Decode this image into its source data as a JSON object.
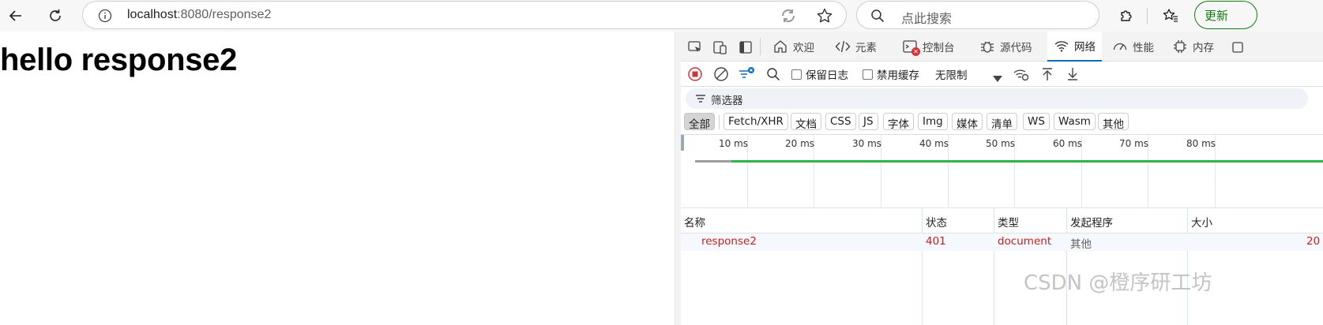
{
  "browser": {
    "address": {
      "host": "localhost",
      "rest": ":8080/response2"
    },
    "search_placeholder": "点此搜索",
    "update_label": "更新"
  },
  "page": {
    "heading": "hello response2"
  },
  "devtools": {
    "tabs": [
      {
        "label": "欢迎",
        "icon": "home-icon"
      },
      {
        "label": "元素",
        "icon": "code-icon"
      },
      {
        "label": "控制台",
        "icon": "console-icon"
      },
      {
        "label": "源代码",
        "icon": "bug-icon"
      },
      {
        "label": "网络",
        "icon": "wifi-icon",
        "active": true
      },
      {
        "label": "性能",
        "icon": "gauge-icon"
      },
      {
        "label": "内存",
        "icon": "chip-icon"
      }
    ],
    "network_toolbar": {
      "preserve_log": "保留日志",
      "disable_cache": "禁用缓存",
      "throttle": "无限制"
    },
    "filter_placeholder": "筛选器",
    "type_filters": [
      "全部",
      "Fetch/XHR",
      "文档",
      "CSS",
      "JS",
      "字体",
      "Img",
      "媒体",
      "清单",
      "WS",
      "Wasm",
      "其他"
    ],
    "timeline_ticks": [
      "10 ms",
      "20 ms",
      "30 ms",
      "40 ms",
      "50 ms",
      "60 ms",
      "70 ms",
      "80 ms"
    ],
    "columns": [
      "名称",
      "状态",
      "类型",
      "发起程序",
      "大小"
    ],
    "requests": [
      {
        "name": "response2",
        "status": "401",
        "type": "document",
        "initiator": "其他",
        "size": "20"
      }
    ],
    "colors": {
      "error_text": "#c5221f",
      "active_tab": "#0f6cbd",
      "download_bar": "#32b34a"
    }
  },
  "watermark": "CSDN @橙序研工坊"
}
